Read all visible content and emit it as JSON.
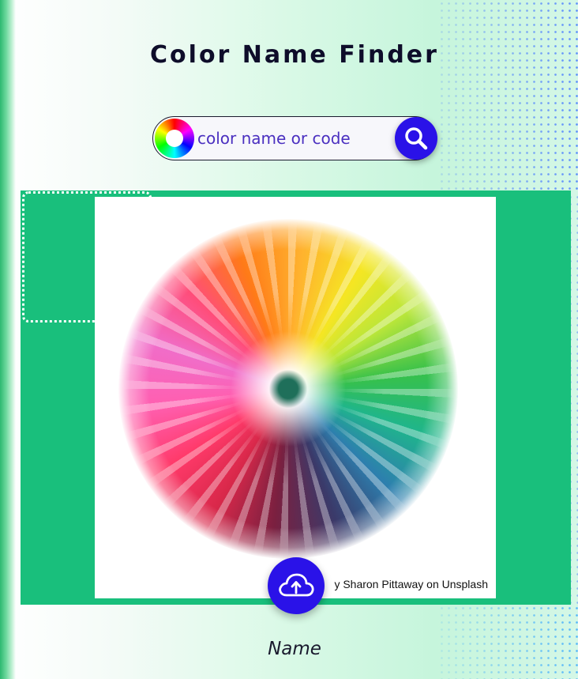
{
  "header": {
    "title": "Color Name Finder"
  },
  "search": {
    "placeholder": "color name or code",
    "value": ""
  },
  "image": {
    "credit": "y Sharon Pittaway on Unsplash"
  },
  "result": {
    "label": "Name"
  },
  "icons": {
    "color_wheel": "color-wheel-icon",
    "search": "magnifier-icon",
    "upload": "cloud-upload-icon"
  },
  "colors": {
    "accent": "#2a12e8",
    "panel": "#19bf7c",
    "title": "#0e0d2a",
    "input_text": "#4a2fc0"
  }
}
